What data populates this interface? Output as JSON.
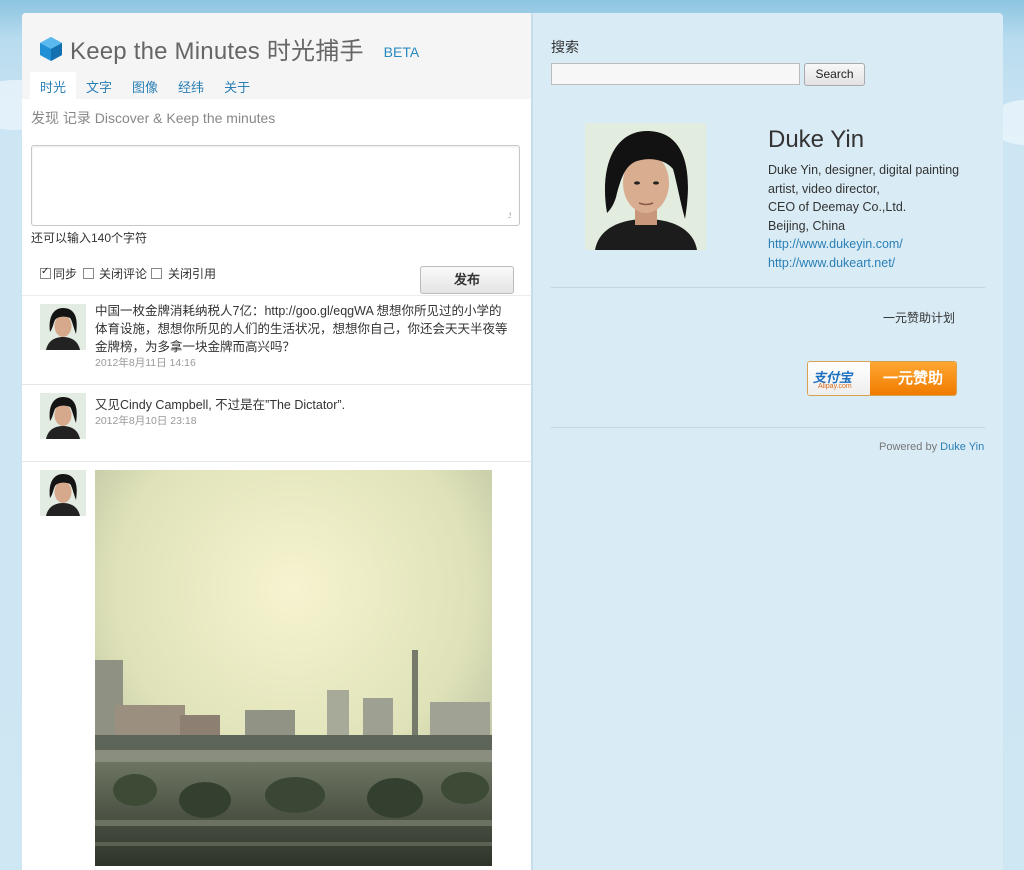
{
  "header": {
    "title": "Keep the Minutes 时光捕手",
    "badge": "BETA",
    "tabs": [
      "时光",
      "文字",
      "图像",
      "经纬",
      "关于"
    ],
    "tagline": "发现 记录 Discover & Keep the minutes"
  },
  "composer": {
    "text_value": "",
    "char_count": "还可以输入140个字符",
    "options": [
      {
        "label": "同步",
        "checked": true
      },
      {
        "label": "关闭评论",
        "checked": false
      },
      {
        "label": "关闭引用",
        "checked": false
      }
    ],
    "publish_label": "发布"
  },
  "posts": [
    {
      "text": "中国一枚金牌消耗纳税人7亿：http://goo.gl/eqgWA 想想你所见过的小学的体育设施，想想你所见的人们的生活状况，想想你自己，你还会天天半夜等金牌榜，为多拿一块金牌而高兴吗？",
      "time": "2012年8月11日 14:16"
    },
    {
      "text": "又见Cindy Campbell, 不过是在”The Dictator”.",
      "time": "2012年8月10日 23:18"
    }
  ],
  "sidebar": {
    "search_label": "搜索",
    "search_value": "",
    "search_button": "Search",
    "profile": {
      "name": "Duke Yin",
      "bio_lines": [
        "Duke Yin, designer, digital painting artist, video director,",
        "CEO of Deemay Co.,Ltd.",
        "Beijing, China"
      ],
      "links": [
        "http://www.dukeyin.com/",
        "http://www.dukeart.net/"
      ]
    },
    "sponsor_title": "一元赞助计划",
    "alipay": {
      "logo_cn": "支付宝",
      "logo_en": "Alipay.com",
      "label": "一元赞助"
    },
    "powered_by_prefix": "Powered by",
    "powered_by_name": "Duke Yin"
  },
  "colors": {
    "accent": "#2a7fb5",
    "background_sky": "#b9dcef",
    "alipay_orange": "#f07b00"
  }
}
